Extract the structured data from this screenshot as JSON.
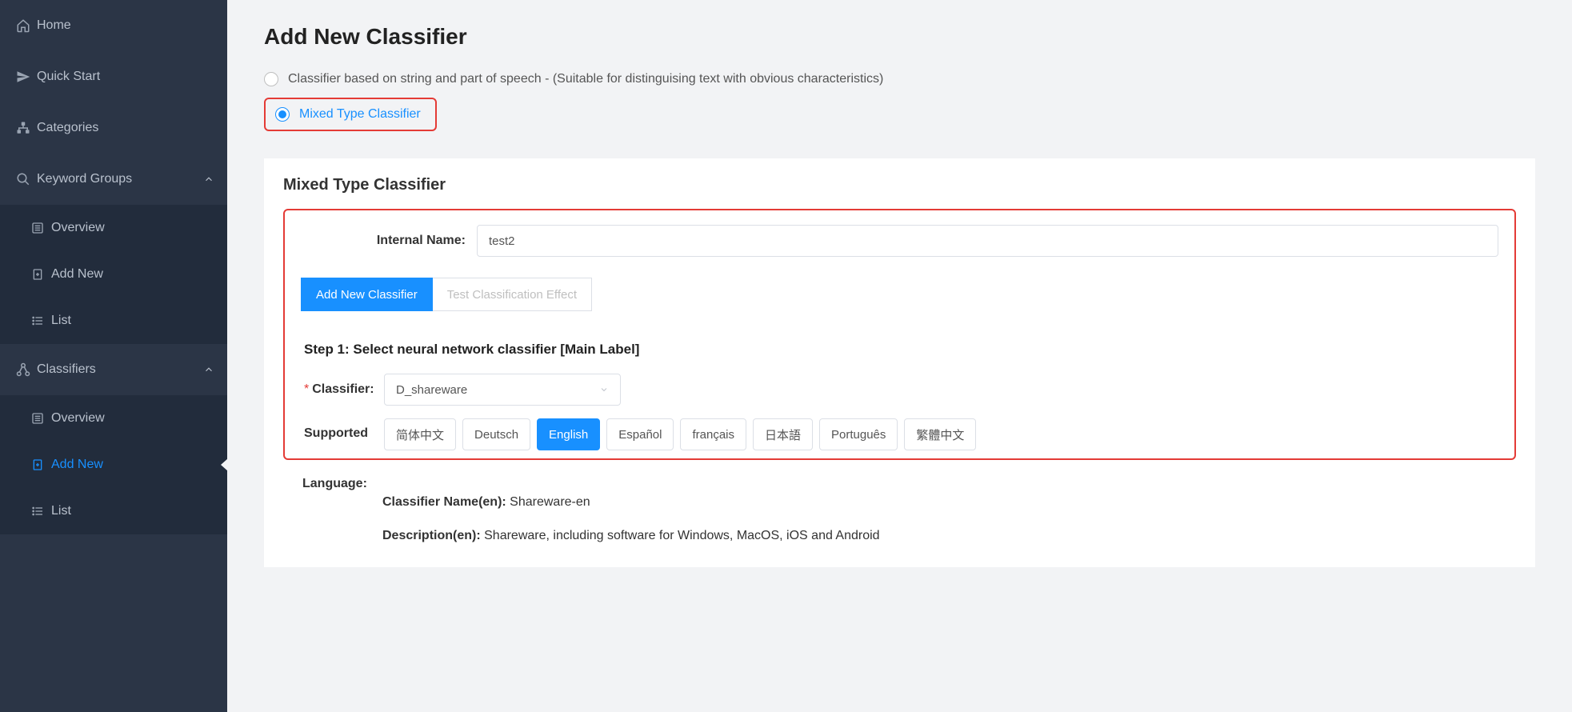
{
  "sidebar": {
    "items": [
      {
        "label": "Home"
      },
      {
        "label": "Quick Start"
      },
      {
        "label": "Categories"
      },
      {
        "label": "Keyword Groups"
      },
      {
        "label": "Overview"
      },
      {
        "label": "Add New"
      },
      {
        "label": "List"
      },
      {
        "label": "Classifiers"
      },
      {
        "label": "Overview"
      },
      {
        "label": "Add New"
      },
      {
        "label": "List"
      }
    ]
  },
  "page": {
    "title": "Add New Classifier",
    "radio1": "Classifier based on string and part of speech - (Suitable for distinguising text with obvious characteristics)",
    "radio2": "Mixed Type Classifier"
  },
  "card": {
    "title": "Mixed Type Classifier",
    "internal_name_label": "Internal Name:",
    "internal_name_value": "test2",
    "tabs": {
      "add": "Add New Classifier",
      "test": "Test Classification Effect"
    },
    "step1_title": "Step 1: Select neural network classifier [Main Label]",
    "classifier_label": "Classifier:",
    "classifier_value": "D_shareware",
    "supported_label": "Supported",
    "language_label": "Language:",
    "languages": [
      "简体中文",
      "Deutsch",
      "English",
      "Español",
      "français",
      "日本語",
      "Português",
      "繁體中文"
    ],
    "selected_language_index": 2,
    "classifier_name_label": "Classifier Name(en):",
    "classifier_name_value": "Shareware-en",
    "description_label": "Description(en):",
    "description_value": "Shareware, including software for Windows, MacOS, iOS and Android"
  }
}
